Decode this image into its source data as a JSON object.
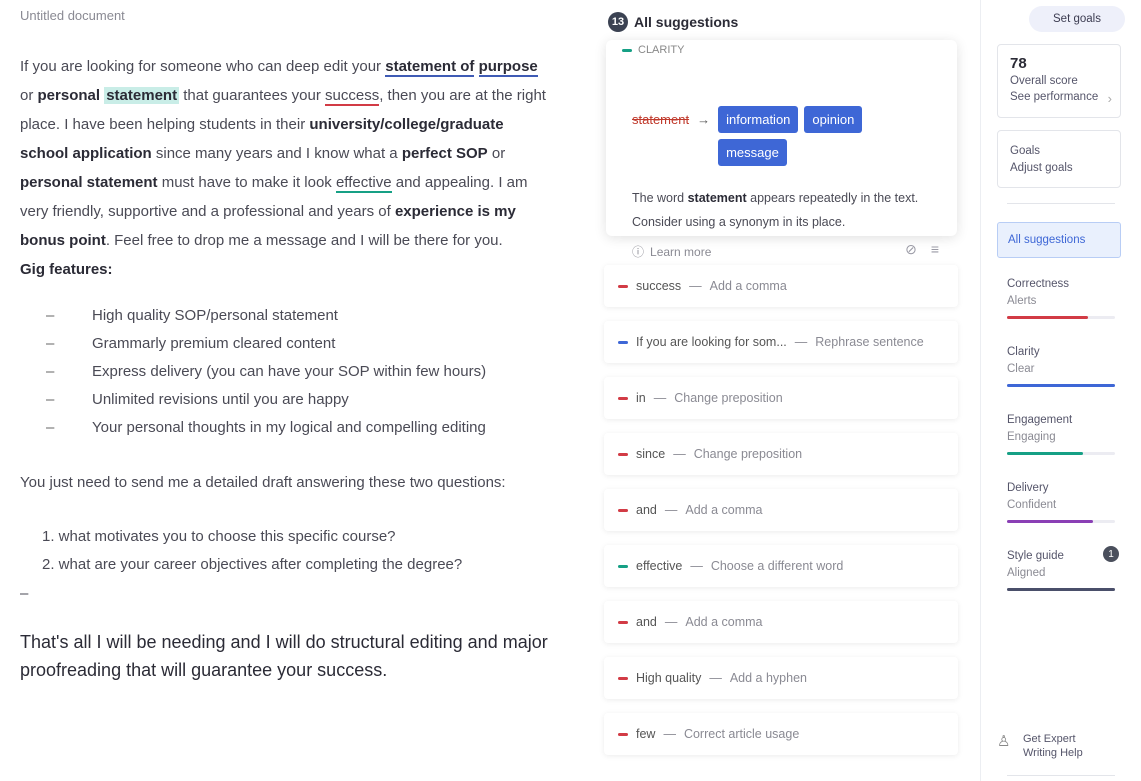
{
  "document": {
    "title": "Untitled document",
    "p1": {
      "t1": "If you are looking for someone who can deep edit your ",
      "statement_of": "statement of",
      "purpose": "purpose",
      "t2": " or ",
      "personal": "personal",
      "statement_box": "statement",
      "t3": " that guarantees your ",
      "success": "success",
      "t4": ", then you are at the right place. I have been helping students in their ",
      "university": "university/college/graduate school application",
      "t5": " since many years and I know what a ",
      "perfect_sop": "perfect SOP",
      "t6": " or ",
      "personal_statement": "personal statement",
      "t7": " must have to make it look ",
      "effective": "effective",
      "t8": " and appealing. I am very friendly, supportive and a professional and years of ",
      "experience": "experience is my bonus point",
      "t9": ". Feel free to drop me a message and I will be there for you."
    },
    "features_heading": "Gig features:",
    "features": [
      "High quality SOP/personal statement",
      "Grammarly premium cleared content",
      "Express delivery (you can have your SOP within few hours)",
      "Unlimited revisions until you are happy",
      "Your personal thoughts in my logical and compelling editing"
    ],
    "questions_intro": "You just need to send me a detailed draft answering these two questions:",
    "questions": [
      "1. what motivates you to choose this specific course?",
      "2. what are your career objectives after completing the degree?"
    ],
    "dash": "–",
    "outro": "That's all I will be needing and I will do structural editing and major proofreading that will guarantee your success."
  },
  "suggestions": {
    "count": "13",
    "header_label": "All suggestions",
    "card": {
      "category": "CLARITY",
      "original_word": "statement",
      "arrow": "→",
      "options": [
        "information",
        "opinion",
        "message"
      ],
      "explain_pre": "The word ",
      "explain_word": "statement",
      "explain_post": " appears repeatedly in the text. Consider using a synonym in its place.",
      "learn_more": "Learn more"
    },
    "rows": [
      {
        "word": "success",
        "action": "Add a comma",
        "color": "#d23b45"
      },
      {
        "word": "If you are looking for som...",
        "action": "Rephrase sentence",
        "color": "#3e67d6"
      },
      {
        "word": "in",
        "action": "Change preposition",
        "color": "#d23b45"
      },
      {
        "word": "since",
        "action": "Change preposition",
        "color": "#d23b45"
      },
      {
        "word": "and",
        "action": "Add a comma",
        "color": "#d23b45"
      },
      {
        "word": "effective",
        "action": "Choose a different word",
        "color": "#16a085"
      },
      {
        "word": "and",
        "action": "Add a comma",
        "color": "#d23b45"
      },
      {
        "word": "High quality",
        "action": "Add a hyphen",
        "color": "#d23b45"
      },
      {
        "word": "few",
        "action": "Correct article usage",
        "color": "#d23b45"
      }
    ]
  },
  "sidebar": {
    "goals_button": "Set goals",
    "score_value": "78",
    "score_label": "Overall score",
    "score_sub": "See performance",
    "goals_label": "Goals",
    "goals_sub": "Adjust goals",
    "all_suggestions": "All suggestions",
    "categories": [
      {
        "name": "Correctness",
        "sub": "Alerts",
        "color": "#d23b45",
        "fill": 0.75,
        "badge": ""
      },
      {
        "name": "Clarity",
        "sub": "Clear",
        "color": "#3e67d6",
        "fill": 1.0,
        "badge": ""
      },
      {
        "name": "Engagement",
        "sub": "Engaging",
        "color": "#16a085",
        "fill": 0.7,
        "badge": ""
      },
      {
        "name": "Delivery",
        "sub": "Confident",
        "color": "#8a3fb5",
        "fill": 0.8,
        "badge": ""
      },
      {
        "name": "Style guide",
        "sub": "Aligned",
        "color": "#4a4f6a",
        "fill": 1.0,
        "badge": "1"
      }
    ],
    "expert_line1": "Get Expert",
    "expert_line2": "Writing Help"
  }
}
